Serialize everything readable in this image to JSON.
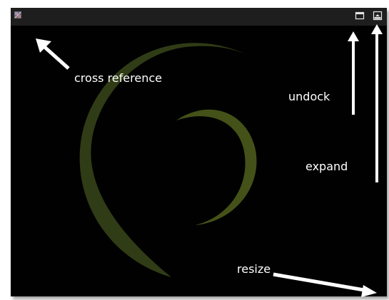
{
  "window": {
    "background": "#010101",
    "titlebar_color": "#1e1e1e",
    "spiral_color": "#3b4a13"
  },
  "titlebar": {
    "left_icon": "cross-reference-icon",
    "right_icons": [
      "undock-icon",
      "expand-icon"
    ]
  },
  "annotations": {
    "cross_reference": "cross reference",
    "undock": "undock",
    "expand": "expand",
    "resize": "resize",
    "color": "#ffffff"
  }
}
